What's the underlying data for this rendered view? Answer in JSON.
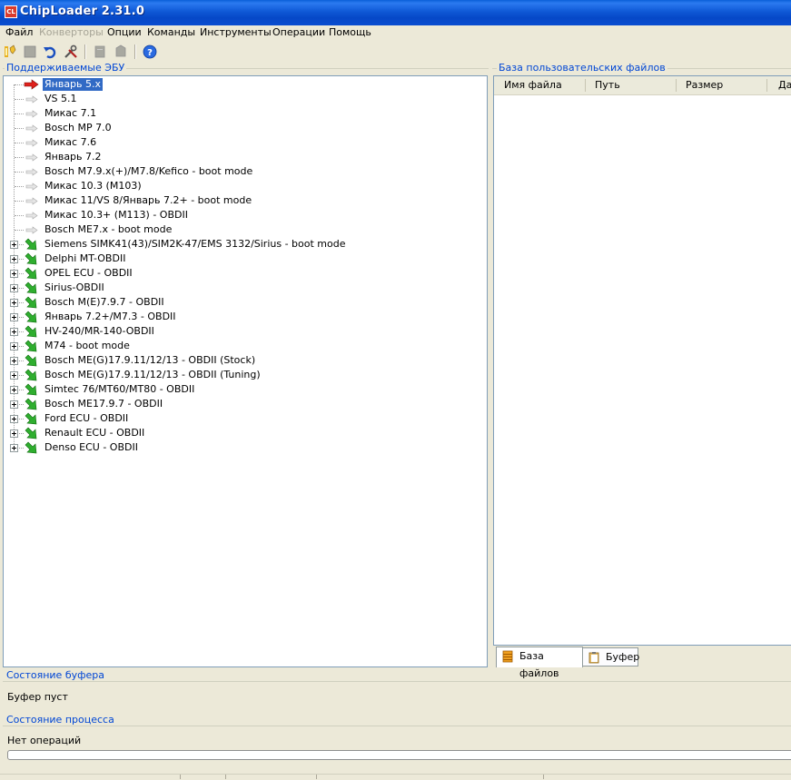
{
  "window": {
    "title": "ChipLoader 2.31.0",
    "icon_name": "app-icon",
    "icon_text": "CL"
  },
  "menu": [
    {
      "label": "Файл",
      "enabled": true
    },
    {
      "label": "Конверторы",
      "enabled": false
    },
    {
      "label": "Опции",
      "enabled": true
    },
    {
      "label": "Команды",
      "enabled": true
    },
    {
      "label": "Инструменты",
      "enabled": true
    },
    {
      "label": "Операции",
      "enabled": true
    },
    {
      "label": "Помощь",
      "enabled": true
    }
  ],
  "toolbar": [
    {
      "icon": "connect-icon",
      "enabled": true
    },
    {
      "icon": "stop-icon",
      "enabled": false
    },
    {
      "icon": "undo-icon",
      "enabled": true
    },
    {
      "icon": "tools-icon",
      "enabled": true
    },
    {
      "icon": "read-icon",
      "enabled": false
    },
    {
      "icon": "write-icon",
      "enabled": false
    },
    {
      "icon": "help-icon",
      "enabled": true
    }
  ],
  "ecu_panel": {
    "title": "Поддерживаемые ЭБУ",
    "items": [
      {
        "label": "Январь 5.x",
        "kind": "selected",
        "expandable": false
      },
      {
        "label": "VS 5.1",
        "kind": "leaf",
        "expandable": false
      },
      {
        "label": "Микас 7.1",
        "kind": "leaf",
        "expandable": false
      },
      {
        "label": "Bosch MP 7.0",
        "kind": "leaf",
        "expandable": false
      },
      {
        "label": "Микас 7.6",
        "kind": "leaf",
        "expandable": false
      },
      {
        "label": "Январь 7.2",
        "kind": "leaf",
        "expandable": false
      },
      {
        "label": "Bosch M7.9.x(+)/M7.8/Kefico - boot mode",
        "kind": "leaf",
        "expandable": false
      },
      {
        "label": "Микас 10.3 (M103)",
        "kind": "leaf",
        "expandable": false
      },
      {
        "label": "Микас 11/VS 8/Январь 7.2+ - boot mode",
        "kind": "leaf",
        "expandable": false
      },
      {
        "label": "Микас 10.3+ (M113) - OBDII",
        "kind": "leaf",
        "expandable": false
      },
      {
        "label": "Bosch ME7.x - boot mode",
        "kind": "leaf",
        "expandable": false
      },
      {
        "label": "Siemens SIMK41(43)/SIM2K-47/EMS 3132/Sirius - boot mode",
        "kind": "group",
        "expandable": true
      },
      {
        "label": "Delphi MT-OBDII",
        "kind": "group",
        "expandable": true
      },
      {
        "label": "OPEL ECU - OBDII",
        "kind": "group",
        "expandable": true
      },
      {
        "label": "Sirius-OBDII",
        "kind": "group",
        "expandable": true
      },
      {
        "label": "Bosch M(E)7.9.7 - OBDII",
        "kind": "group",
        "expandable": true
      },
      {
        "label": "Январь 7.2+/M7.3 - OBDII",
        "kind": "group",
        "expandable": true
      },
      {
        "label": "HV-240/MR-140-OBDII",
        "kind": "group",
        "expandable": true
      },
      {
        "label": "M74 - boot mode",
        "kind": "group",
        "expandable": true
      },
      {
        "label": "Bosch ME(G)17.9.11/12/13 - OBDII (Stock)",
        "kind": "group",
        "expandable": true
      },
      {
        "label": "Bosch ME(G)17.9.11/12/13 - OBDII (Tuning)",
        "kind": "group",
        "expandable": true
      },
      {
        "label": "Simtec 76/MT60/MT80 - OBDII",
        "kind": "group",
        "expandable": true
      },
      {
        "label": "Bosch ME17.9.7 - OBDII",
        "kind": "group",
        "expandable": true
      },
      {
        "label": "Ford ECU - OBDII",
        "kind": "group",
        "expandable": true
      },
      {
        "label": "Renault ECU - OBDII",
        "kind": "group",
        "expandable": true
      },
      {
        "label": "Denso ECU - OBDII",
        "kind": "group",
        "expandable": true
      }
    ]
  },
  "files_panel": {
    "title": "База пользовательских файлов",
    "columns": [
      "Имя файла",
      "Путь",
      "Размер",
      "Дата"
    ],
    "rows": []
  },
  "tabs": [
    {
      "label": "База файлов",
      "icon": "database-icon",
      "active": true
    },
    {
      "label": "Буфер",
      "icon": "clipboard-icon",
      "active": false
    }
  ],
  "buffer_status": {
    "title": "Состояние буфера",
    "text": "Буфер пуст"
  },
  "process_status": {
    "title": "Состояние процесса",
    "text": "Нет операций",
    "progress": 0
  },
  "colors": {
    "title_bar": "#0a4dd0",
    "group_title": "#0046d5",
    "selection": "#316ac5",
    "arrow_green": "#2fae2f",
    "arrow_red": "#e0201b"
  }
}
